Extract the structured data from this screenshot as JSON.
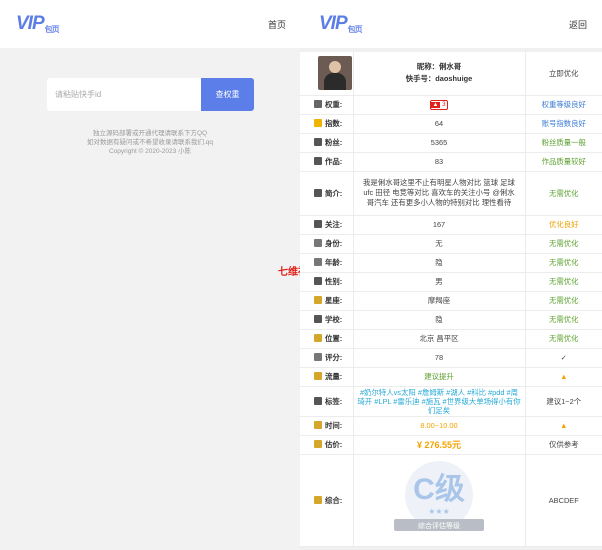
{
  "left": {
    "logo": "VIP",
    "logo_sub": "包页",
    "nav_home": "首页",
    "search_placeholder": "请粘贴快手id",
    "search_button": "查权重",
    "footer_line1": "独立源码部署或开通代理请联系下方QQ",
    "footer_line2": "如对数据有疑问或不希望收录请联系我们.qq",
    "footer_line3": "Copyright © 2020-2023 小陈"
  },
  "watermark": "七维社区",
  "right": {
    "logo": "VIP",
    "logo_sub": "包页",
    "back": "返回",
    "profile": {
      "nickname": "昵称：俐水哥",
      "account": "快手号：daoshuige",
      "action": "立即优化"
    },
    "rows": [
      {
        "label": "权重:",
        "value": "",
        "eval": "权重等级良好",
        "eval_color": "blue",
        "icon_color": "#666"
      },
      {
        "label": "指数:",
        "value": "64",
        "eval": "账号指数良好",
        "eval_color": "blue",
        "icon_color": "#f0b400"
      },
      {
        "label": "粉丝:",
        "value": "5365",
        "eval": "粉丝质量一般",
        "eval_color": "green",
        "icon_color": "#555"
      },
      {
        "label": "作品:",
        "value": "83",
        "eval": "作品质量较好",
        "eval_color": "green",
        "icon_color": "#555"
      },
      {
        "label": "简介:",
        "value": "我是俐水哥这里不止有明星人物对比 篮球 足球 ufc 田径 电竞等对比 喜欢车的关注小号 @俐水哥汽车 还有更多小人物的特别对比 理性看待",
        "eval": "无需优化",
        "eval_color": "green",
        "icon_color": "#555"
      },
      {
        "label": "关注:",
        "value": "167",
        "eval": "优化良好",
        "eval_color": "orange",
        "icon_color": "#555"
      },
      {
        "label": "身份:",
        "value": "无",
        "eval": "无需优化",
        "eval_color": "green",
        "icon_color": "#777"
      },
      {
        "label": "年龄:",
        "value": "隐",
        "eval": "无需优化",
        "eval_color": "green",
        "icon_color": "#777"
      },
      {
        "label": "性别:",
        "value": "男",
        "eval": "无需优化",
        "eval_color": "green",
        "icon_color": "#555"
      },
      {
        "label": "星座:",
        "value": "摩羯座",
        "eval": "无需优化",
        "eval_color": "green",
        "icon_color": "#d4a72c"
      },
      {
        "label": "学校:",
        "value": "隐",
        "eval": "无需优化",
        "eval_color": "green",
        "icon_color": "#555"
      },
      {
        "label": "位置:",
        "value": "北京 昌平区",
        "eval": "无需优化",
        "eval_color": "green",
        "icon_color": "#d4a72c"
      },
      {
        "label": "评分:",
        "value": "78",
        "eval": "✓",
        "eval_color": "plain",
        "icon_color": "#777"
      },
      {
        "label": "流量:",
        "value": "建议提升",
        "eval": "▲",
        "eval_color": "warn",
        "icon_color": "#d4a72c"
      },
      {
        "label": "标签:",
        "value": "#奶尔特人vs太阳 #詹姆斯 #湖人 #科比 #pdd #周琦开 #LPL #雷乐迪 #施瓦 #世界级大单场得小有你们足矣",
        "eval": "建议1~2个",
        "eval_color": "plain",
        "icon_color": "#555"
      },
      {
        "label": "时间:",
        "value": "8.00~10.00",
        "eval": "▲",
        "eval_color": "warn",
        "icon_color": "#d4a72c"
      },
      {
        "label": "估价:",
        "value": "¥ 276.55元",
        "eval": "仅供参考",
        "eval_color": "plain",
        "icon_color": "#d4a72c"
      },
      {
        "label": "综合:",
        "value": "",
        "eval": "ABCDEF",
        "eval_color": "plain",
        "icon_color": "#d4a72c"
      }
    ],
    "weight_badge": "3",
    "grade_text": "C级",
    "grade_stars": "★★★",
    "grade_banner": "综合评估等级"
  },
  "colors": {
    "accent": "#5b7ee8",
    "green": "#5aa02c",
    "blue": "#3a7bd5",
    "orange": "#f0a000",
    "red": "#e0201b"
  }
}
